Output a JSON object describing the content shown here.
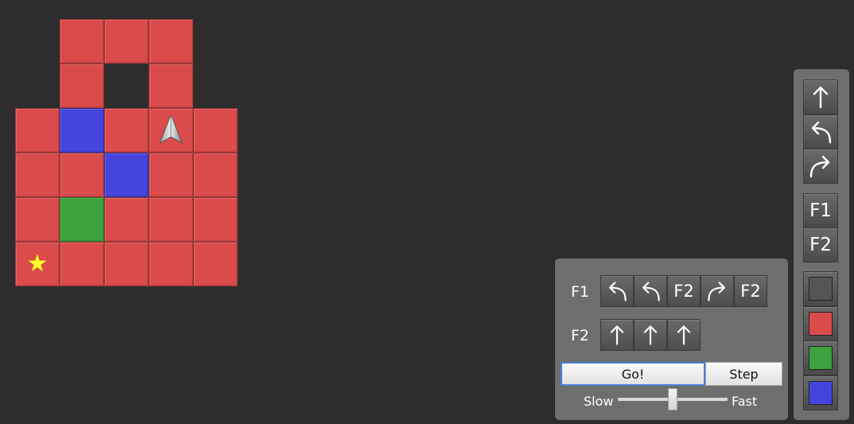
{
  "board": {
    "cols": 5,
    "rows": 6,
    "tiles": [
      [
        "empty",
        "red",
        "red",
        "red",
        "empty"
      ],
      [
        "empty",
        "red",
        "empty",
        "red",
        "empty"
      ],
      [
        "red",
        "blue",
        "red",
        "red",
        "red"
      ],
      [
        "red",
        "red",
        "blue",
        "red",
        "red"
      ],
      [
        "red",
        "green",
        "red",
        "red",
        "red"
      ],
      [
        "red",
        "red",
        "red",
        "red",
        "red"
      ]
    ],
    "stars": [
      {
        "row": 5,
        "col": 0
      }
    ],
    "robot": {
      "row": 2,
      "col": 3,
      "facing": "up"
    },
    "star_glyph": "★"
  },
  "program": {
    "functions": [
      {
        "label": "F1",
        "slots": [
          "left-icon",
          "left-icon",
          "F2",
          "right-icon",
          "F2"
        ]
      },
      {
        "label": "F2",
        "slots": [
          "forward-icon",
          "forward-icon",
          "forward-icon"
        ]
      }
    ],
    "go_label": "Go!",
    "step_label": "Step",
    "speed": {
      "slow_label": "Slow",
      "fast_label": "Fast",
      "value": 0.5
    }
  },
  "palette": {
    "commands": [
      "forward-icon",
      "left-icon",
      "right-icon"
    ],
    "functions": [
      "F1",
      "F2"
    ],
    "colors": [
      {
        "name": "gray",
        "hex": "#555555"
      },
      {
        "name": "red",
        "hex": "#db4b4b"
      },
      {
        "name": "green",
        "hex": "#3da13d"
      },
      {
        "name": "blue",
        "hex": "#4545dd"
      }
    ]
  },
  "colors": {
    "red": "#db4b4b",
    "blue": "#4545dd",
    "green": "#3da13d",
    "background": "#2d2d2d",
    "panel": "#6e6e6e"
  }
}
